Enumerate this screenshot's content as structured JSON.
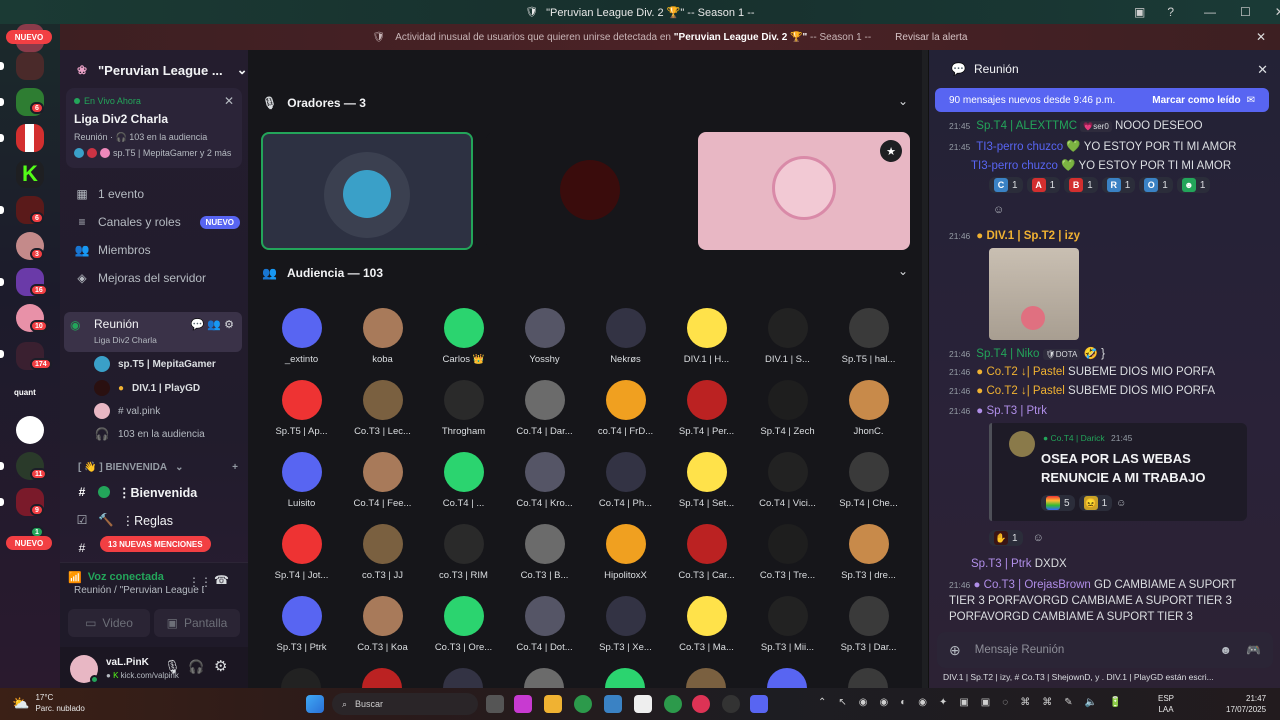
{
  "window": {
    "title": "\"Peruvian League Div. 2 🏆\" -- Season 1 --"
  },
  "notice": {
    "prefix": "Actividad inusual de usuarios que quieren unirse detectada en",
    "server": "\"Peruvian League Div. 2 🏆\"",
    "suffix": "-- Season 1 --",
    "action": "Revisar la alerta"
  },
  "rail": {
    "new_top": "NUEVO",
    "new_bottom": "NUEVO",
    "badges": [
      "6",
      "6",
      "3",
      "16",
      "10",
      "174",
      "11",
      "9",
      "1"
    ],
    "quant": "quant"
  },
  "sidebar": {
    "server_name": "\"Peruvian League ...",
    "live_label": "En Vivo Ahora",
    "event_title": "Liga Div2 Charla",
    "event_meta": "Reunión · 🎧 103 en la audiencia",
    "event_people": "sp.T5 | MepitaGamer y 2 más",
    "events": "1 evento",
    "channels_roles": "Canales y roles",
    "new_badge": "NUEVO",
    "members": "Miembros",
    "boosts": "Mejoras del servidor",
    "stage_channel": "Reunión",
    "stage_sub": "Liga Div2 Charla",
    "stage_users": [
      "sp.T5 | MepitaGamer",
      "DIV.1 | PlayGD",
      "# val.pink",
      "103 en la audiencia"
    ],
    "category": "[ 👋 ] BIENVENIDA",
    "welcome": "⋮Bienvenida",
    "rules": "⋮Reglas",
    "mentions": "13 NUEVAS MENCIONES",
    "voice_connected": "Voz conectada",
    "voice_where": "Reunión / \"Peruvian League Div. ...",
    "video": "Video",
    "screen": "Pantalla",
    "user_name": "vaL.PinK",
    "user_status": "kick.com/valpink"
  },
  "stage": {
    "speakers_header": "Oradores — 3",
    "audience_header": "Audiencia — 103",
    "audience": [
      [
        "_extinto",
        "koba",
        "Carlos 👑",
        "Yosshy",
        "Nekrøs",
        "DIV.1 | H...",
        "DIV.1 | S...",
        "Sp.T5 | hal..."
      ],
      [
        "Sp.T5 | Ap...",
        "Co.T3 | Lec...",
        "Throgham",
        "Co.T4 | Dar...",
        "co.T4 | FrD...",
        "Sp.T4 | Per...",
        "Sp.T4 | Zech",
        "JhonC."
      ],
      [
        "Luisito",
        "Co.T4 | Fee...",
        "Co.T4 | ...",
        "Co.T4 | Kro...",
        "Co.T4 | Ph...",
        "Sp.T4 | Set...",
        "Co.T4 | Vici...",
        "Sp.T4 | Che..."
      ],
      [
        "Sp.T4 | Jot...",
        "co.T3 | JJ",
        "co.T3 | RIM",
        "Co.T3 | B...",
        "HipolitoxX",
        "Co.T3 | Car...",
        "Co.T3 | Tre...",
        "Sp.T3 | dre..."
      ],
      [
        "Sp.T3 | Ptrk",
        "Co.T3 | Koa",
        "Co.T3 | Ore...",
        "Co.T4 | Dot...",
        "Sp.T3 | Xe...",
        "Co.T3 | Ma...",
        "Sp.T3 | Mii...",
        "Sp.T3 | Dar..."
      ]
    ]
  },
  "chat": {
    "title": "Reunión",
    "new_messages": "90 mensajes nuevos desde 9:46 p.m.",
    "mark_read": "Marcar como leído",
    "input_placeholder": "Mensaje Reunión",
    "typing": "DIV.1 | Sp.T2 | izy, # Co.T3 | ShejownD, y . DIV.1 | PlayGD están escri...",
    "messages": [
      {
        "time": "21:45",
        "author": "Sp.T4 | ALEXTTMC",
        "tag": "ser0",
        "text": "NOOO DESEOO"
      },
      {
        "time": "21:45",
        "author": "TI3-perro chuzco",
        "text": "YO ESTOY POR TI MI AMOR"
      },
      {
        "time": "",
        "author": "TI3-perro chuzco",
        "text": "YO ESTOY POR TI MI AMOR"
      },
      {
        "time": "21:46",
        "author": "DIV.1 | Sp.T2 | izy",
        "text": ""
      },
      {
        "time": "21:46",
        "author": "Sp.T4 | Niko",
        "tag": "DOTA",
        "text": "}"
      },
      {
        "time": "21:46",
        "author": "Co.T2 ↓| Pastel",
        "text": "SUBEME DIOS MIO PORFA"
      },
      {
        "time": "21:46",
        "author": "Co.T2 ↓| Pastel",
        "text": "SUBEME DIOS MIO PORFA"
      },
      {
        "time": "21:46",
        "author": "Sp.T3 | Ptrk",
        "text": ""
      },
      {
        "time": "",
        "author": "Sp.T3 | Ptrk",
        "text": "DXDX"
      },
      {
        "time": "21:46",
        "author": "Co.T3 | OrejasBrown",
        "text": "GD CAMBIAME A SUPORT TIER 3 PORFAVORGD CAMBIAME A SUPORT TIER 3 PORFAVORGD CAMBIAME A SUPORT TIER 3"
      }
    ],
    "reactions": [
      {
        "glyph": "C",
        "count": "1"
      },
      {
        "glyph": "A",
        "count": "1"
      },
      {
        "glyph": "B",
        "count": "1"
      },
      {
        "glyph": "R",
        "count": "1"
      },
      {
        "glyph": "O",
        "count": "1"
      },
      {
        "glyph": "☻",
        "count": "1"
      }
    ],
    "embed": {
      "author": "Co.T4 | Darick",
      "time": "21:45",
      "text": "OSEA POR LAS WEBAS RENUNCIE A MI TRABAJO",
      "r1": "5",
      "r2": "1",
      "r3": "1"
    }
  },
  "taskbar": {
    "weather_temp": "17°C",
    "weather_desc": "Parc. nublado",
    "search": "Buscar",
    "lang": "ESP",
    "lang2": "LAA",
    "time": "21:47",
    "date": "17/07/2025"
  },
  "colors": {
    "accent": "#5865f2",
    "green": "#23a55a",
    "red": "#f23f43",
    "gold": "#f0b232",
    "purple": "#b08ee8"
  }
}
